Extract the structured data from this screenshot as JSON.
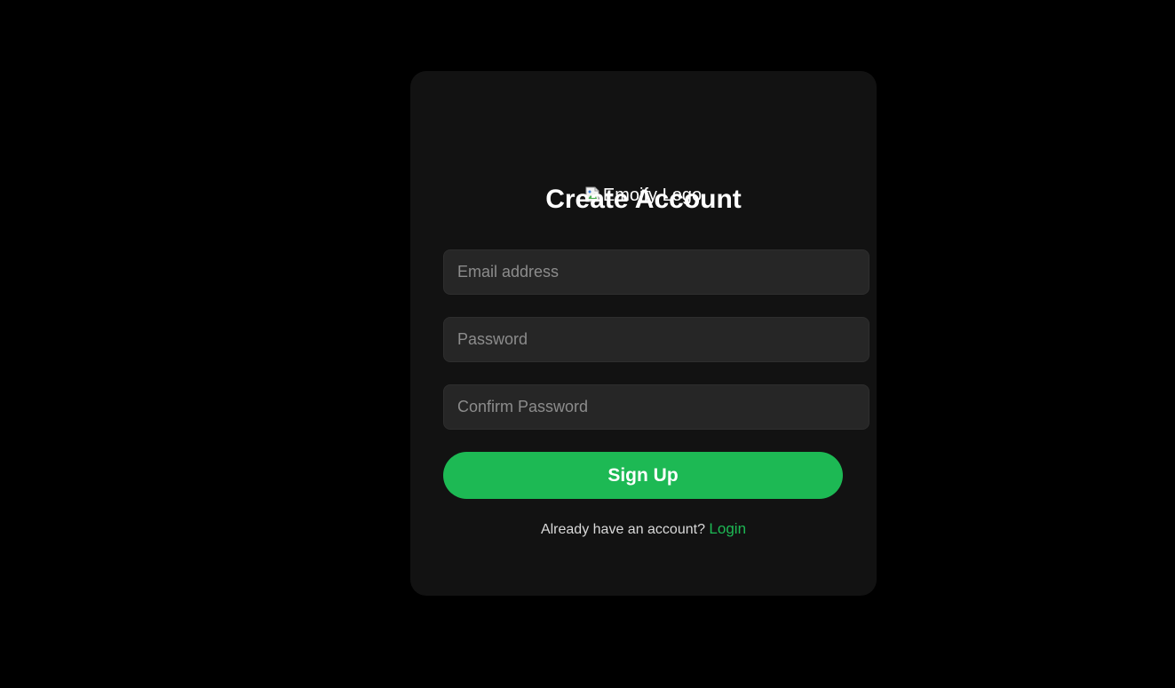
{
  "logo": {
    "alt_text": "Emoify Logo",
    "icon": "broken-image-icon"
  },
  "form": {
    "title": "Create Account",
    "email_placeholder": "Email address",
    "password_placeholder": "Password",
    "confirm_password_placeholder": "Confirm Password",
    "submit_label": "Sign Up"
  },
  "footer": {
    "prompt_text": "Already have an account?",
    "login_link": "Login"
  },
  "colors": {
    "background": "#000000",
    "card": "#121212",
    "input": "#262626",
    "accent": "#1db954"
  }
}
